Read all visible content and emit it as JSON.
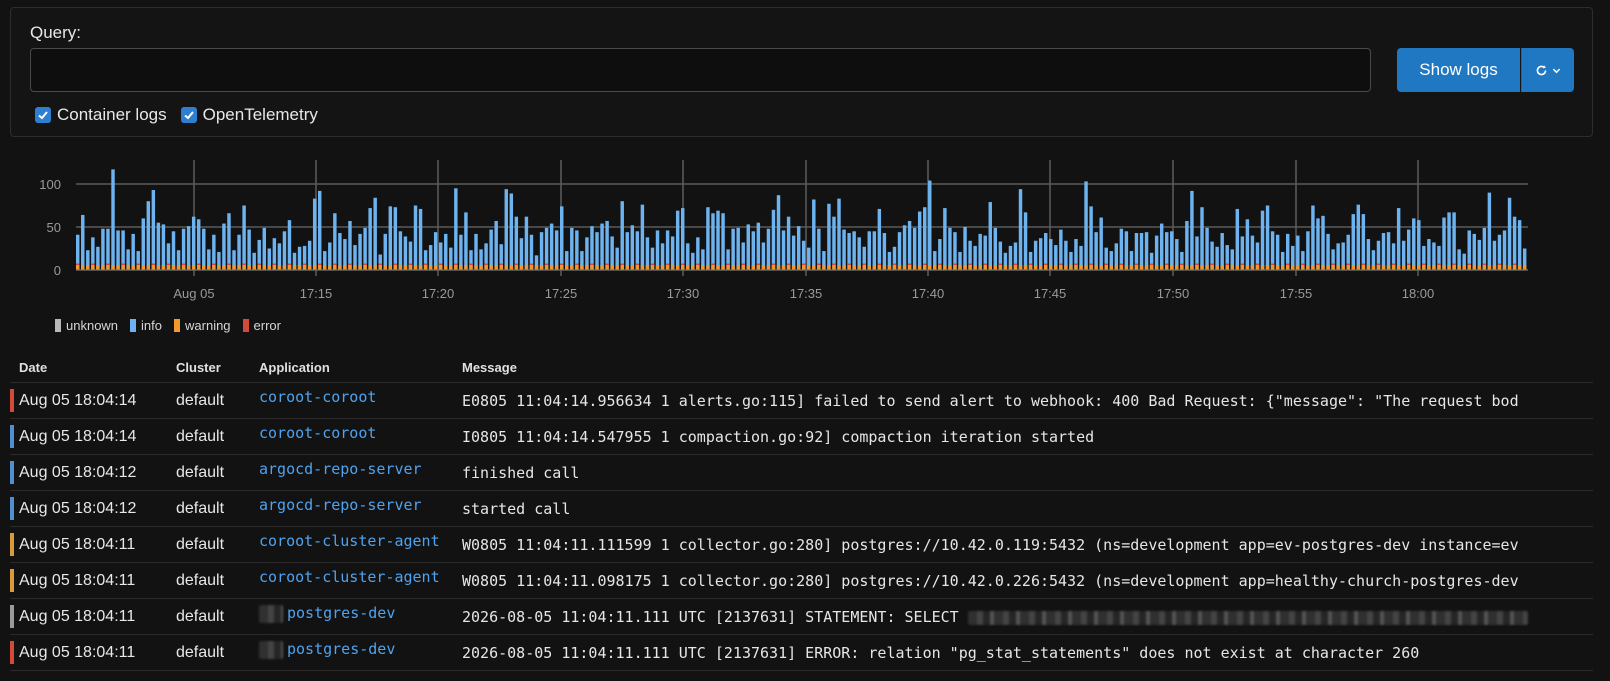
{
  "query": {
    "label": "Query:",
    "input_value": "",
    "placeholder": "",
    "show_logs_label": "Show logs",
    "refresh_icon": "refresh-icon",
    "checkboxes": [
      {
        "label": "Container logs",
        "checked": true
      },
      {
        "label": "OpenTelemetry",
        "checked": true
      }
    ]
  },
  "chart_data": {
    "type": "bar",
    "stacked": true,
    "y_ticks": [
      "0",
      "50",
      "100"
    ],
    "ylim": [
      0,
      110
    ],
    "x_ticks": [
      "Aug 05",
      "17:15",
      "17:20",
      "17:25",
      "17:30",
      "17:35",
      "17:40",
      "17:45",
      "17:50",
      "17:55",
      "18:00"
    ],
    "xlim": [
      "17:05:05",
      "18:05:05"
    ],
    "colors": {
      "unknown": "#b8b8b8",
      "info": "#6cb3f0",
      "warning": "#f2992e",
      "error": "#d44a3a"
    },
    "series_totals": [
      41,
      64,
      23,
      38,
      27,
      48,
      48,
      117,
      46,
      46,
      24,
      42,
      22,
      60,
      80,
      93,
      55,
      53,
      31,
      45,
      23,
      48,
      51,
      62,
      59,
      48,
      24,
      41,
      21,
      54,
      66,
      23,
      41,
      75,
      47,
      20,
      35,
      49,
      25,
      37,
      31,
      45,
      58,
      20,
      27,
      28,
      34,
      83,
      92,
      22,
      32,
      66,
      43,
      36,
      57,
      29,
      42,
      49,
      72,
      84,
      18,
      42,
      74,
      73,
      45,
      39,
      33,
      75,
      71,
      23,
      29,
      44,
      32,
      42,
      26,
      95,
      41,
      67,
      23,
      42,
      24,
      31,
      47,
      57,
      30,
      94,
      89,
      62,
      37,
      62,
      41,
      17,
      44,
      49,
      54,
      46,
      74,
      22,
      49,
      46,
      22,
      38,
      51,
      44,
      54,
      57,
      39,
      26,
      80,
      44,
      52,
      45,
      76,
      38,
      26,
      46,
      31,
      46,
      39,
      69,
      72,
      31,
      20,
      38,
      24,
      73,
      66,
      69,
      66,
      24,
      48,
      49,
      32,
      53,
      45,
      55,
      32,
      48,
      70,
      87,
      46,
      62,
      40,
      51,
      34,
      26,
      82,
      48,
      22,
      77,
      62,
      83,
      47,
      43,
      45,
      38,
      27,
      45,
      45,
      71,
      43,
      21,
      27,
      44,
      52,
      57,
      49,
      68,
      73,
      104,
      22,
      36,
      72,
      49,
      44,
      21,
      50,
      34,
      28,
      42,
      40,
      79,
      49,
      33,
      20,
      28,
      32,
      94,
      67,
      21,
      34,
      37,
      43,
      36,
      29,
      47,
      34,
      21,
      36,
      28,
      103,
      74,
      44,
      61,
      26,
      22,
      31,
      48,
      45,
      22,
      43,
      43,
      44,
      20,
      40,
      54,
      44,
      45,
      36,
      21,
      57,
      92,
      39,
      73,
      49,
      33,
      27,
      43,
      29,
      24,
      71,
      39,
      59,
      40,
      32,
      69,
      75,
      45,
      41,
      21,
      42,
      28,
      40,
      22,
      45,
      75,
      60,
      63,
      42,
      24,
      31,
      32,
      41,
      65,
      76,
      65,
      36,
      23,
      34,
      43,
      44,
      31,
      72,
      34,
      47,
      60,
      58,
      28,
      36,
      32,
      28,
      61,
      67,
      67,
      24,
      19,
      46,
      42,
      35,
      49,
      90,
      34,
      41,
      46,
      84,
      62,
      58,
      25
    ],
    "legend": [
      "unknown",
      "info",
      "warning",
      "error"
    ]
  },
  "table": {
    "headers": {
      "date": "Date",
      "cluster": "Cluster",
      "application": "Application",
      "message": "Message"
    },
    "rows": [
      {
        "severity": "error",
        "date": "Aug 05 18:04:14",
        "cluster": "default",
        "application": "coroot-coroot",
        "message": "E0805 11:04:14.956634 1 alerts.go:115] failed to send alert to webhook: 400 Bad Request: {\"message\": \"The request bod"
      },
      {
        "severity": "info",
        "date": "Aug 05 18:04:14",
        "cluster": "default",
        "application": "coroot-coroot",
        "message": "I0805 11:04:14.547955 1 compaction.go:92] compaction iteration started"
      },
      {
        "severity": "info",
        "date": "Aug 05 18:04:12",
        "cluster": "default",
        "application": "argocd-repo-server",
        "message": "finished call"
      },
      {
        "severity": "info",
        "date": "Aug 05 18:04:12",
        "cluster": "default",
        "application": "argocd-repo-server",
        "message": "started call"
      },
      {
        "severity": "warning",
        "date": "Aug 05 18:04:11",
        "cluster": "default",
        "application": "coroot-cluster-agent",
        "message": "W0805 11:04:11.111599 1 collector.go:280] postgres://10.42.0.119:5432 (ns=development app=ev-postgres-dev instance=ev"
      },
      {
        "severity": "warning",
        "date": "Aug 05 18:04:11",
        "cluster": "default",
        "application": "coroot-cluster-agent",
        "message": "W0805 11:04:11.098175 1 collector.go:280] postgres://10.42.0.226:5432 (ns=development app=healthy-church-postgres-dev"
      },
      {
        "severity": "unknown",
        "date": "Aug 05 18:04:11",
        "cluster": "default",
        "application": "postgres-dev",
        "app_redacted": true,
        "message": "2026-08-05 11:04:11.111 UTC [2137631] STATEMENT: SELECT",
        "msg_redacted": true
      },
      {
        "severity": "error",
        "date": "Aug 05 18:04:11",
        "cluster": "default",
        "application": "postgres-dev",
        "app_redacted": true,
        "message": "2026-08-05 11:04:11.111 UTC [2137631] ERROR: relation \"pg_stat_statements\" does not exist at character 260"
      }
    ]
  }
}
